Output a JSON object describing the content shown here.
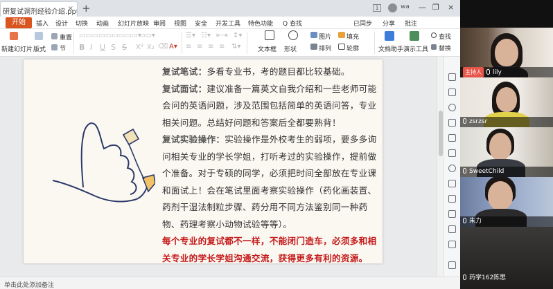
{
  "tabbar": {
    "doc_tab": "研复试调剂经验介绍.pptx",
    "tab_close": "×",
    "new_tab": "+",
    "badge": "1",
    "user": "wa",
    "win_min": "—",
    "win_max": "❐",
    "win_close": "×"
  },
  "menu": {
    "start": "开始",
    "items": [
      "插入",
      "设计",
      "切换",
      "动画",
      "幻灯片放映",
      "审阅",
      "视图",
      "安全",
      "开发工具",
      "特色功能",
      "Q 查找"
    ],
    "right": [
      "已同步",
      "分享",
      "批注"
    ]
  },
  "ribbon": {
    "new_slide": "新建幻灯片",
    "layout": "版式",
    "reset": "重置",
    "section": "节",
    "textbox": "文本框",
    "shape": "形状",
    "picture": "图片",
    "fill": "填充",
    "arrange": "排列",
    "outline": "轮廓",
    "doc_helper": "文档助手",
    "presenter": "演示工具",
    "find": "查找",
    "replace": "替换"
  },
  "slide": {
    "p1_head": "复试笔试：",
    "p1_body": "多看专业书，考的题目都比较基础。",
    "p2_head": "复试面试：",
    "p2_body": "建议准备一篇英文自我介绍和一些老师可能会问的英语问题，涉及范围包括简单的英语问答，专业相关问题。总结好问题和答案后全都要熟背！",
    "p3_head": "复试实验操作：",
    "p3_body": "实验操作是外校考生的弱项，要多多询问相关专业的学长学姐，打听考过的实验操作，提前做个准备。对于专硕的同学，必须把时间全部放在专业课和面试上！会在笔试里面考察实验操作（药化画装置、药剂干湿法制粒步骤、药分用不同方法鉴别同一种药物、药理考察小动物试验等等）。",
    "p4": "每个专业的复试都不一样，不能闭门造车，必须多和相关专业的学长学姐沟通交流，获得更多有利的资源。"
  },
  "statusbar": {
    "text": "单击此处添加备注"
  },
  "video": {
    "tiles": [
      {
        "name": "lily",
        "host_tag": "主持人"
      },
      {
        "name": "zsrzsr"
      },
      {
        "name": "SweetChild"
      },
      {
        "name": "朱力"
      },
      {
        "name": "药学162陈思"
      }
    ]
  },
  "colors": {
    "accent": "#d9541e",
    "highlight_red": "#c41a1a",
    "host_tag": "#e8564a"
  }
}
